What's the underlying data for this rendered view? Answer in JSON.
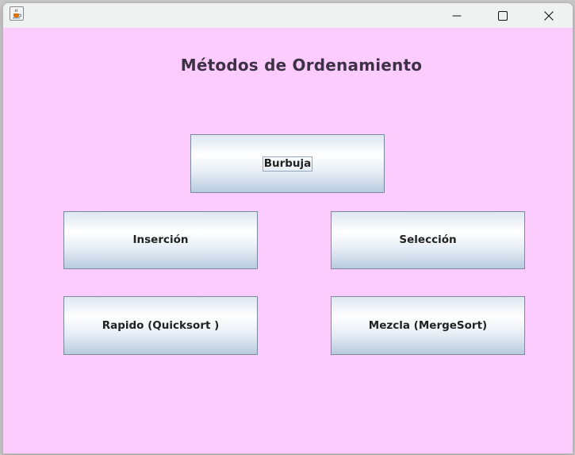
{
  "window": {
    "icon": "java-cup-icon",
    "controls": {
      "minimize_icon": "minimize-icon",
      "maximize_icon": "maximize-icon",
      "close_icon": "close-icon"
    }
  },
  "content": {
    "background_color": "#fdccfe",
    "title": "Métodos de Ordenamiento"
  },
  "buttons": {
    "burbuja": "Burbuja",
    "insercion": "Inserción",
    "seleccion": "Selección",
    "rapido": "Rapido (Quicksort )",
    "mezcla": "Mezcla (MergeSort)",
    "focused": "burbuja"
  }
}
